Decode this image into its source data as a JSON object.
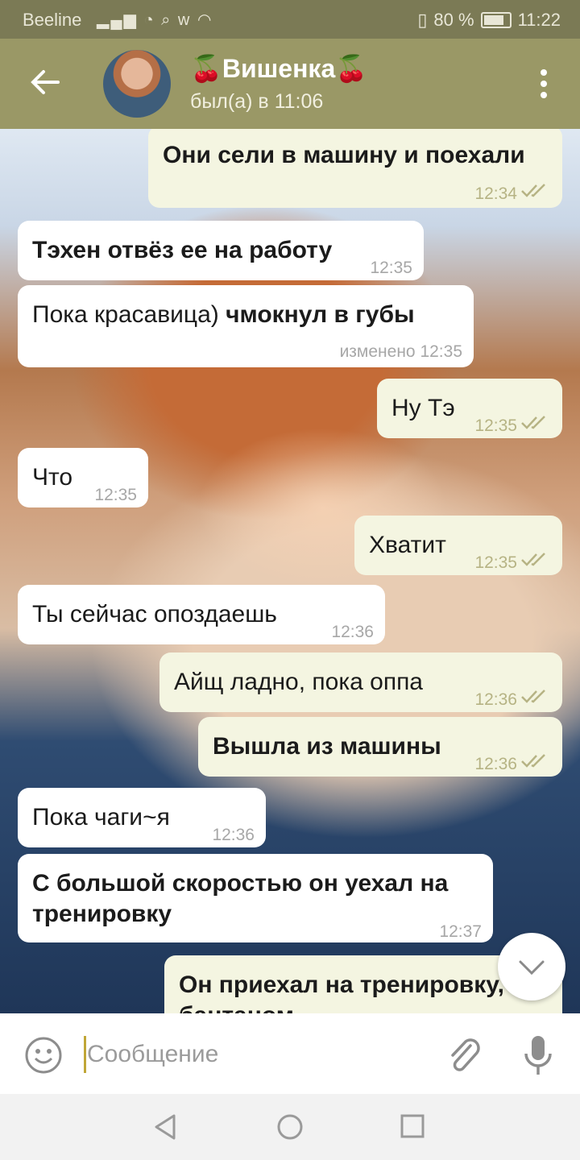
{
  "status_bar": {
    "carrier": "Beeline",
    "battery": "80 %",
    "time": "11:22",
    "battery_level": 0.8
  },
  "header": {
    "title": "🍒Вишенка🍒",
    "subtitle": "был(а) в 11:06"
  },
  "messages": [
    {
      "dir": "out",
      "text_bold": "Они сели в машину и поехали",
      "time": "12:34",
      "read": true
    },
    {
      "dir": "in",
      "text_bold": "Тэхен отвёз ее на работу",
      "time": "12:35"
    },
    {
      "dir": "in",
      "text_plain": "Пока красавица) ",
      "text_bold": "чмокнул в губы",
      "time": "изменено 12:35"
    },
    {
      "dir": "out",
      "text_plain": "Ну Тэ",
      "time": "12:35",
      "read": true
    },
    {
      "dir": "in",
      "text_plain": "Что",
      "time": "12:35"
    },
    {
      "dir": "out",
      "text_plain": "Хватит",
      "time": "12:35",
      "read": true
    },
    {
      "dir": "in",
      "text_plain": "Ты сейчас опоздаешь",
      "time": "12:36"
    },
    {
      "dir": "out",
      "text_plain": "Айщ ладно, пока оппа",
      "time": "12:36",
      "read": true
    },
    {
      "dir": "out",
      "text_bold": "Вышла из машины",
      "time": "12:36",
      "read": true
    },
    {
      "dir": "in",
      "text_plain": "Пока чаги~я",
      "time": "12:36"
    },
    {
      "dir": "in",
      "text_bold": "С большой скоростью он уехал на тренировку",
      "time": "12:37"
    },
    {
      "dir": "out",
      "text_bold": "Он приехал на тренировку, бантаном",
      "time": ""
    }
  ],
  "input": {
    "placeholder": "Сообщение",
    "value": ""
  },
  "icons": {
    "back": "arrow-left-icon",
    "menu": "kebab-menu-icon",
    "emoji": "smiley-icon",
    "attach": "paperclip-icon",
    "mic": "microphone-icon",
    "scroll": "chevron-down-icon",
    "read": "double-check-icon"
  },
  "colors": {
    "header": "#9a9866",
    "status_bar": "#7b7a55",
    "outgoing_bubble": "#f4f5e1",
    "incoming_bubble": "#ffffff",
    "check": "#b6b384"
  }
}
